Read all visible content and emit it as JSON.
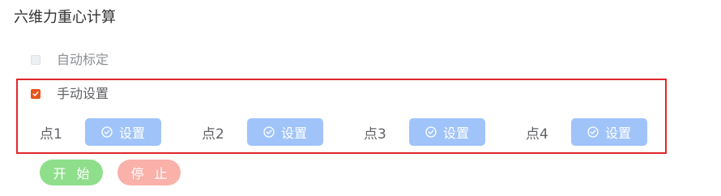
{
  "title": "六维力重心计算",
  "options": {
    "auto": {
      "label": "自动标定",
      "checked": false
    },
    "manual": {
      "label": "手动设置",
      "checked": true
    }
  },
  "points": [
    {
      "label": "点1",
      "button": "设置"
    },
    {
      "label": "点2",
      "button": "设置"
    },
    {
      "label": "点3",
      "button": "设置"
    },
    {
      "label": "点4",
      "button": "设置"
    }
  ],
  "controls": {
    "start": "开 始",
    "stop": "停 止"
  },
  "colors": {
    "checkbox_checked": "#e6541c",
    "frame_border": "#e0262a",
    "set_button": "#a0c4f9",
    "start_button": "#8fde8b",
    "stop_button": "#f9b1aa"
  },
  "icons": {
    "set_button_icon": "check-circle-icon",
    "checkbox_mark": "checkmark-icon"
  }
}
